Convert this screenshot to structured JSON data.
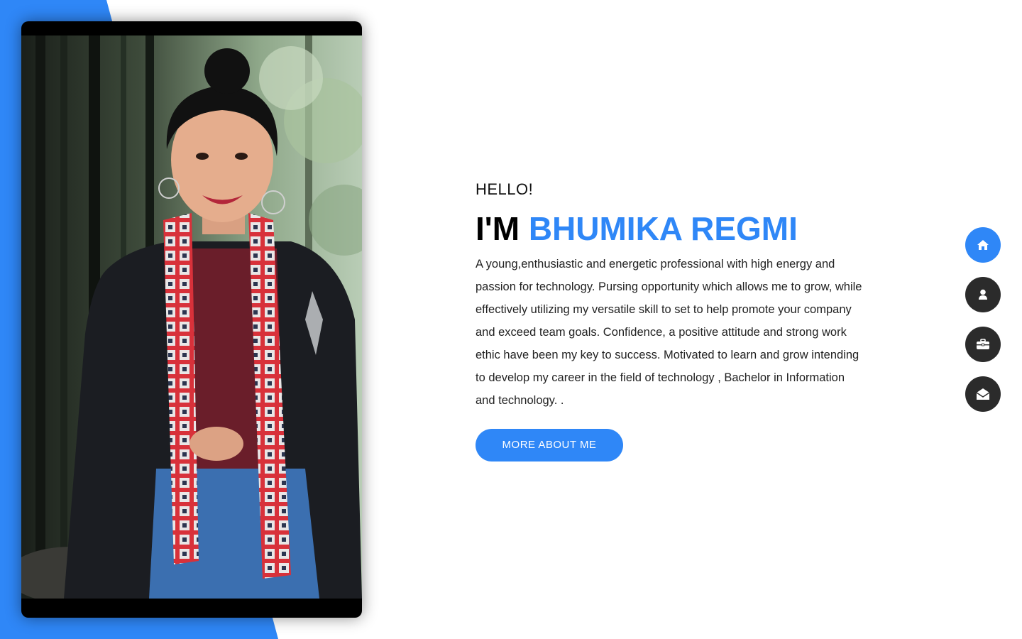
{
  "theme": {
    "accent": "#2f87f7",
    "dark": "#2b2b2b",
    "background": "#ffffff"
  },
  "profile_photo": {
    "alt": "Bhumika Regmi"
  },
  "hero": {
    "greeting": "HELLO!",
    "im_prefix": "I'M",
    "name": "BHUMIKA REGMI",
    "intro": "A young,enthusiastic and energetic professional with high energy and passion for technology. Pursing opportunity which allows me to grow, while effectively utilizing my versatile skill to set to help promote your company and exceed team goals. Confidence, a positive attitude and strong work ethic have been my key to success. Motivated to learn and grow intending to develop my career in the field of technology , Bachelor in Information and technology. .",
    "cta_label": "MORE ABOUT ME"
  },
  "side_nav": {
    "items": [
      {
        "icon": "home-icon",
        "active": true
      },
      {
        "icon": "user-icon",
        "active": false
      },
      {
        "icon": "briefcase-icon",
        "active": false
      },
      {
        "icon": "envelope-open-icon",
        "active": false
      }
    ]
  }
}
